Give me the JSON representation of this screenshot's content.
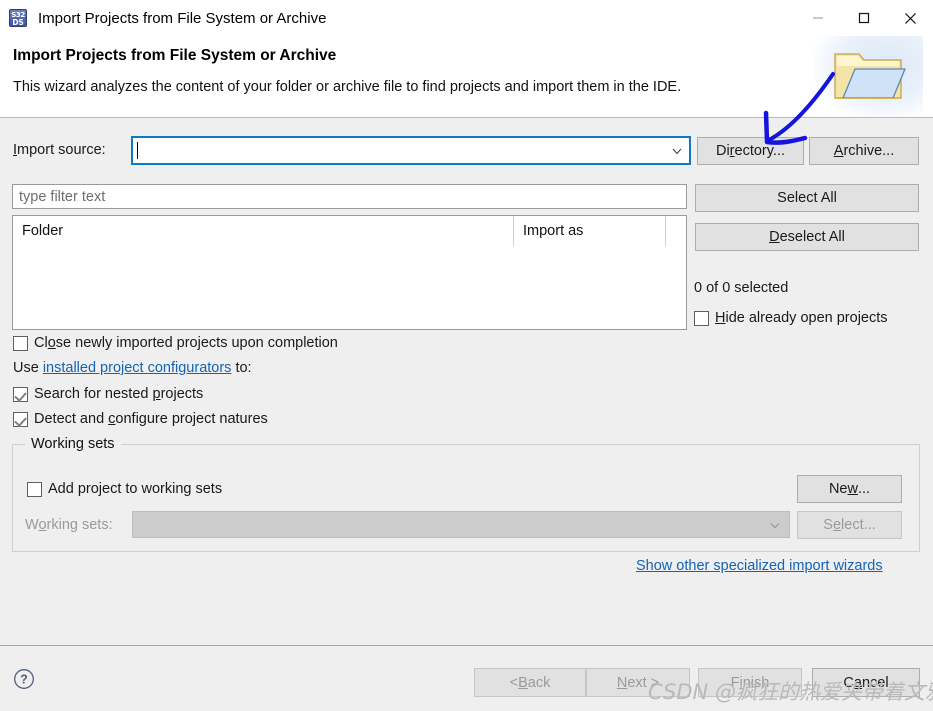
{
  "window": {
    "title": "Import Projects from File System or Archive",
    "icon_name": "s32ds-app-icon",
    "icon_line1": "S32",
    "icon_line2": "DS",
    "minimize_label": "Minimize",
    "maximize_label": "Maximize",
    "close_label": "Close"
  },
  "header": {
    "title": "Import Projects from File System or Archive",
    "description": "This wizard analyzes the content of your folder or archive file to find projects and import them in the IDE.",
    "banner_icon": "folder-with-document-icon"
  },
  "import_source": {
    "label_pre": "I",
    "label_post": "mport source:",
    "value": "",
    "dropdown_icon": "chevron-down-icon"
  },
  "buttons": {
    "directory_pre": "Di",
    "directory_mnemonic": "r",
    "directory_post": "ectory...",
    "archive_mnemonic": "A",
    "archive_post": "rchive...",
    "select_all": "Select All",
    "deselect_mnemonic": "D",
    "deselect_post": "eselect All"
  },
  "filter": {
    "placeholder": "type filter text",
    "value": ""
  },
  "table": {
    "columns": [
      "Folder",
      "Import as"
    ],
    "rows": []
  },
  "status": {
    "selected_count": "0 of 0 selected"
  },
  "checkboxes": {
    "hide_open": {
      "mnemonic": "H",
      "rest": "ide already open projects",
      "checked": false
    },
    "close_imported": {
      "pre": "Cl",
      "mnemonic": "o",
      "rest": "se newly imported projects upon completion",
      "checked": false
    },
    "search_nested": {
      "pre": "Search for nested ",
      "mnemonic": "p",
      "rest": "rojects",
      "checked": true
    },
    "detect_natures": {
      "pre": "Detect and ",
      "mnemonic": "c",
      "rest": "onfigure project natures",
      "checked": true
    },
    "add_working_sets": {
      "pre": "Add project to working sets",
      "checked": false
    }
  },
  "configurators": {
    "prefix": "Use ",
    "link": "installed project configurators",
    "suffix": " to:"
  },
  "working_sets": {
    "group_title": "Working sets",
    "label_pre": "W",
    "label_mnemonic": "o",
    "label_post": "rking sets:",
    "combo_value": "",
    "combo_disabled": true,
    "new_pre": "Ne",
    "new_mnemonic": "w",
    "new_post": "...",
    "select_pre": "S",
    "select_mnemonic": "e",
    "select_post": "lect...",
    "select_disabled": true
  },
  "other_wizards_link": "Show other specialized import wizards",
  "footer": {
    "help_icon": "help-circle-icon",
    "back_pre": "< ",
    "back_mnemonic": "B",
    "back_post": "ack",
    "next_mnemonic": "N",
    "next_post": "ext >",
    "finish_pre": "F",
    "finish_mnemonic": "i",
    "finish_post": "nish",
    "cancel_pre": "C",
    "cancel_mnemonic": "a",
    "cancel_post": "ncel",
    "back_disabled": true,
    "next_disabled": true,
    "finish_disabled": true,
    "cancel_disabled": false
  },
  "annotation": {
    "type": "hand-drawn-arrow",
    "color": "#1414dc"
  },
  "watermark": "CSDN @疯狂的热爱夹带着文雅",
  "colors": {
    "focus_border": "#0f7ac0",
    "link": "#1464b4",
    "dialog_bg": "#efefef",
    "header_bg": "#ffffff",
    "button_bg": "#e1e1e1"
  }
}
